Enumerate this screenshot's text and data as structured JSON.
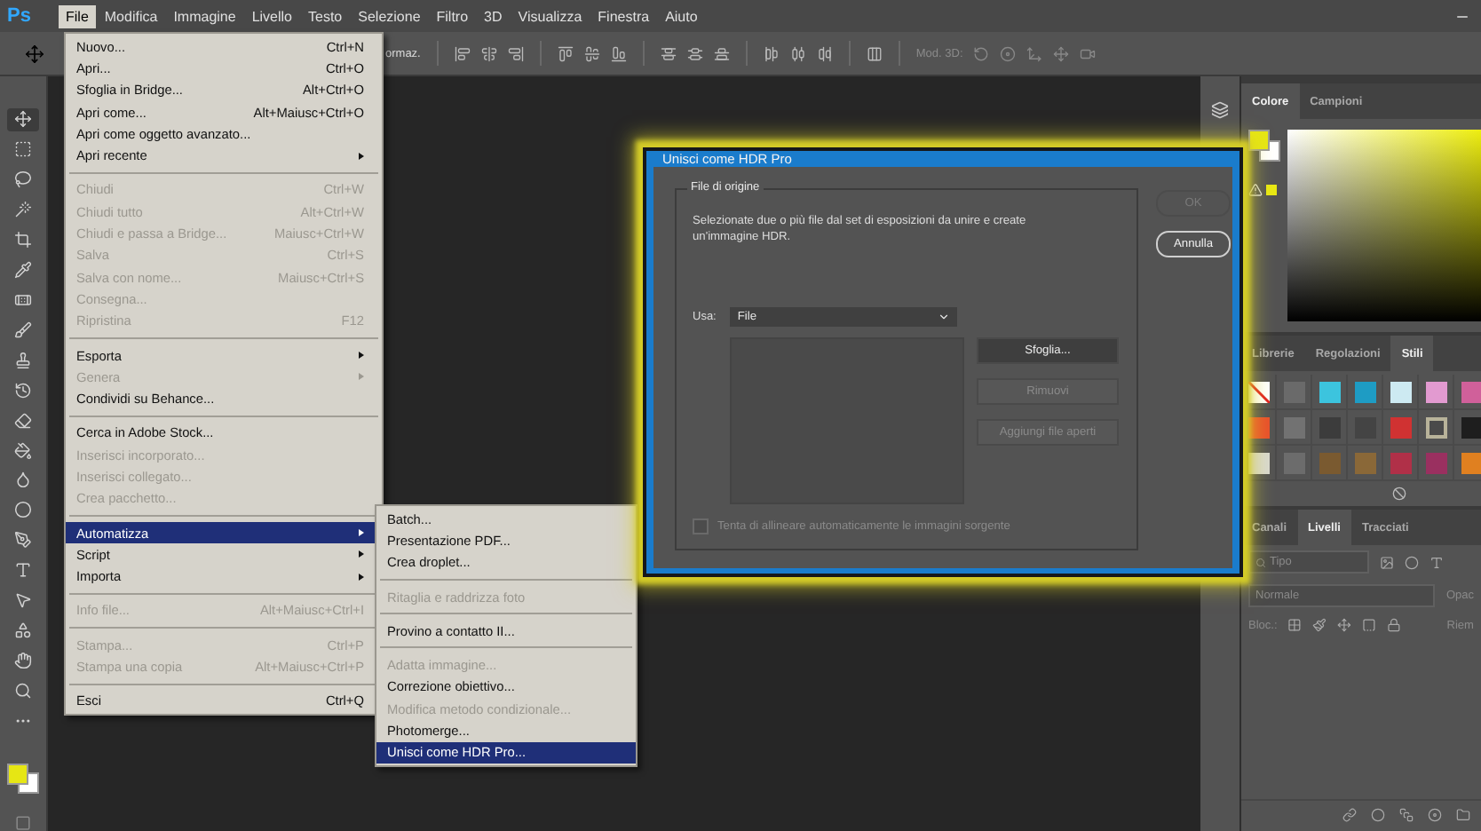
{
  "app_logo": "Ps",
  "menu_bar": [
    {
      "label": "File",
      "selected": true
    },
    {
      "label": "Modifica",
      "selected": false
    },
    {
      "label": "Immagine",
      "selected": false
    },
    {
      "label": "Livello",
      "selected": false
    },
    {
      "label": "Testo",
      "selected": false
    },
    {
      "label": "Selezione",
      "selected": false
    },
    {
      "label": "Filtro",
      "selected": false
    },
    {
      "label": "3D",
      "selected": false
    },
    {
      "label": "Visualizza",
      "selected": false
    },
    {
      "label": "Finestra",
      "selected": false
    },
    {
      "label": "Aiuto",
      "selected": false
    }
  ],
  "options_bar": {
    "cut_label": "ormaz.",
    "mode_3d_label": "Mod. 3D:"
  },
  "file_menu": [
    [
      {
        "label": "Nuovo...",
        "shortcut": "Ctrl+N",
        "disabled": false,
        "submenu": false,
        "selected": false
      },
      {
        "label": "Apri...",
        "shortcut": "Ctrl+O",
        "disabled": false,
        "submenu": false,
        "selected": false
      },
      {
        "label": "Sfoglia in Bridge...",
        "shortcut": "Alt+Ctrl+O",
        "disabled": false,
        "submenu": false,
        "selected": false
      },
      {
        "label": "Apri come...",
        "shortcut": "Alt+Maiusc+Ctrl+O",
        "disabled": false,
        "submenu": false,
        "selected": false
      },
      {
        "label": "Apri come oggetto avanzato...",
        "disabled": false,
        "submenu": false,
        "selected": false
      },
      {
        "label": "Apri recente",
        "disabled": false,
        "submenu": true,
        "selected": false
      }
    ],
    [
      {
        "label": "Chiudi",
        "shortcut": "Ctrl+W",
        "disabled": true,
        "submenu": false,
        "selected": false
      },
      {
        "label": "Chiudi tutto",
        "shortcut": "Alt+Ctrl+W",
        "disabled": true,
        "submenu": false,
        "selected": false
      },
      {
        "label": "Chiudi e passa a Bridge...",
        "shortcut": "Maiusc+Ctrl+W",
        "disabled": true,
        "submenu": false,
        "selected": false
      },
      {
        "label": "Salva",
        "shortcut": "Ctrl+S",
        "disabled": true,
        "submenu": false,
        "selected": false
      },
      {
        "label": "Salva con nome...",
        "shortcut": "Maiusc+Ctrl+S",
        "disabled": true,
        "submenu": false,
        "selected": false
      },
      {
        "label": "Consegna...",
        "disabled": true,
        "submenu": false,
        "selected": false
      },
      {
        "label": "Ripristina",
        "shortcut": "F12",
        "disabled": true,
        "submenu": false,
        "selected": false
      }
    ],
    [
      {
        "label": "Esporta",
        "disabled": false,
        "submenu": true,
        "selected": false
      },
      {
        "label": "Genera",
        "disabled": true,
        "submenu": true,
        "selected": false
      },
      {
        "label": "Condividi su Behance...",
        "disabled": false,
        "submenu": false,
        "selected": false
      }
    ],
    [
      {
        "label": "Cerca in Adobe Stock...",
        "disabled": false,
        "submenu": false,
        "selected": false
      },
      {
        "label": "Inserisci incorporato...",
        "disabled": true,
        "submenu": false,
        "selected": false
      },
      {
        "label": "Inserisci collegato...",
        "disabled": true,
        "submenu": false,
        "selected": false
      },
      {
        "label": "Crea pacchetto...",
        "disabled": true,
        "submenu": false,
        "selected": false
      }
    ],
    [
      {
        "label": "Automatizza",
        "disabled": false,
        "submenu": true,
        "selected": true
      },
      {
        "label": "Script",
        "disabled": false,
        "submenu": true,
        "selected": false
      },
      {
        "label": "Importa",
        "disabled": false,
        "submenu": true,
        "selected": false
      }
    ],
    [
      {
        "label": "Info file...",
        "shortcut": "Alt+Maiusc+Ctrl+I",
        "disabled": true,
        "submenu": false,
        "selected": false
      }
    ],
    [
      {
        "label": "Stampa...",
        "shortcut": "Ctrl+P",
        "disabled": true,
        "submenu": false,
        "selected": false
      },
      {
        "label": "Stampa una copia",
        "shortcut": "Alt+Maiusc+Ctrl+P",
        "disabled": true,
        "submenu": false,
        "selected": false
      }
    ],
    [
      {
        "label": "Esci",
        "shortcut": "Ctrl+Q",
        "disabled": false,
        "submenu": false,
        "selected": false
      }
    ]
  ],
  "automate_submenu": [
    [
      {
        "label": "Batch...",
        "disabled": false,
        "selected": false
      },
      {
        "label": "Presentazione PDF...",
        "disabled": false,
        "selected": false
      },
      {
        "label": "Crea droplet...",
        "disabled": false,
        "selected": false
      }
    ],
    [
      {
        "label": "Ritaglia e raddrizza foto",
        "disabled": true,
        "selected": false
      }
    ],
    [
      {
        "label": "Provino a contatto II...",
        "disabled": false,
        "selected": false
      }
    ],
    [
      {
        "label": "Adatta immagine...",
        "disabled": true,
        "selected": false
      },
      {
        "label": "Correzione obiettivo...",
        "disabled": false,
        "selected": false
      },
      {
        "label": "Modifica metodo condizionale...",
        "disabled": true,
        "selected": false
      },
      {
        "label": "Photomerge...",
        "disabled": false,
        "selected": false
      },
      {
        "label": "Unisci come HDR Pro...",
        "disabled": false,
        "selected": true
      }
    ]
  ],
  "dialog": {
    "title": "Unisci come HDR Pro",
    "group_title": "File di origine",
    "description": "Selezionate due o più file dal set di esposizioni da unire e create un'immagine HDR.",
    "use_label": "Usa:",
    "use_value": "File",
    "buttons": [
      {
        "label": "OK",
        "disabled": true
      },
      {
        "label": "Annulla",
        "disabled": false
      }
    ],
    "side_buttons": [
      {
        "label": "Sfoglia...",
        "disabled": false
      },
      {
        "label": "Rimuovi",
        "disabled": true
      },
      {
        "label": "Aggiungi file aperti",
        "disabled": true
      }
    ],
    "align_option": {
      "label": "Tenta di allineare automaticamente le immagini sorgente",
      "checked": false,
      "disabled": true
    }
  },
  "color_panel": {
    "tabs": [
      {
        "label": "Colore",
        "selected": true
      },
      {
        "label": "Campioni",
        "selected": false
      }
    ]
  },
  "styles_panel": {
    "tabs": [
      {
        "label": "Librerie",
        "selected": false
      },
      {
        "label": "Regolazioni",
        "selected": false
      },
      {
        "label": "Stili",
        "selected": true
      }
    ],
    "swatches": [
      {
        "kind": "none"
      },
      {
        "kind": "fill",
        "color": "#6a6a6a"
      },
      {
        "kind": "fill",
        "color": "#3cc4de"
      },
      {
        "kind": "fill",
        "color": "#1e9cc4"
      },
      {
        "kind": "fill",
        "color": "#cdeaf2"
      },
      {
        "kind": "fill",
        "color": "#e29ad0"
      },
      {
        "kind": "fill",
        "color": "#d0609a"
      },
      {
        "kind": "fill",
        "color": "#e8502c"
      },
      {
        "kind": "fill",
        "color": "#727272"
      },
      {
        "kind": "fill",
        "color": "#3c3c3c"
      },
      {
        "kind": "fill",
        "color": "#444444"
      },
      {
        "kind": "fill",
        "color": "#d03232"
      },
      {
        "kind": "frame",
        "color": "#b8b39a"
      },
      {
        "kind": "fill",
        "color": "#1e1e1e"
      },
      {
        "kind": "fill",
        "color": "#d8d8d0"
      },
      {
        "kind": "fill",
        "color": "#6c6c6c"
      },
      {
        "kind": "fill",
        "color": "#7a5a30"
      },
      {
        "kind": "fill",
        "color": "#8a6838"
      },
      {
        "kind": "fill",
        "color": "#b03048"
      },
      {
        "kind": "fill",
        "color": "#9a3060"
      },
      {
        "kind": "fill",
        "color": "#e08020"
      }
    ]
  },
  "layers_panel": {
    "tabs": [
      {
        "label": "Canali",
        "selected": false
      },
      {
        "label": "Livelli",
        "selected": true
      },
      {
        "label": "Tracciati",
        "selected": false
      }
    ],
    "filter_placeholder": "Tipo",
    "blend_mode": "Normale",
    "opacity_label": "Opac",
    "lock_label": "Bloc.:",
    "fill_label": "Riem"
  }
}
